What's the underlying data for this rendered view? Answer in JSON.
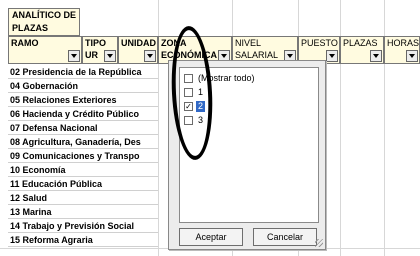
{
  "title": "ANALÍTICO DE PLAZAS",
  "headers": [
    {
      "label": "RAMO"
    },
    {
      "label": "TIPO UR"
    },
    {
      "label": "UNIDAD"
    },
    {
      "label": "ZONA ECONÓMICA"
    },
    {
      "label": "NIVEL SALARIAL"
    },
    {
      "label": "PUESTO"
    },
    {
      "label": "PLAZAS"
    },
    {
      "label": "HORAS"
    }
  ],
  "rows": [
    "02 Presidencia de la República",
    "04 Gobernación",
    "05 Relaciones Exteriores",
    "06 Hacienda y Crédito Público",
    "07 Defensa Nacional",
    "08 Agricultura, Ganadería, Des",
    "09 Comunicaciones y Transpo",
    "10 Economía",
    "11 Educación Pública",
    "12 Salud",
    "13 Marina",
    "14 Trabajo y Previsión Social",
    "15 Reforma Agraria"
  ],
  "filter": {
    "options": [
      {
        "label": "(Mostrar todo)",
        "checked": false,
        "selected": false
      },
      {
        "label": "1",
        "checked": false,
        "selected": false
      },
      {
        "label": "2",
        "checked": true,
        "selected": true
      },
      {
        "label": "3",
        "checked": false,
        "selected": false
      }
    ],
    "accept_label": "Aceptar",
    "cancel_label": "Cancelar"
  },
  "colors": {
    "header_fill": "#fffbe0",
    "selection": "#3169c6"
  }
}
